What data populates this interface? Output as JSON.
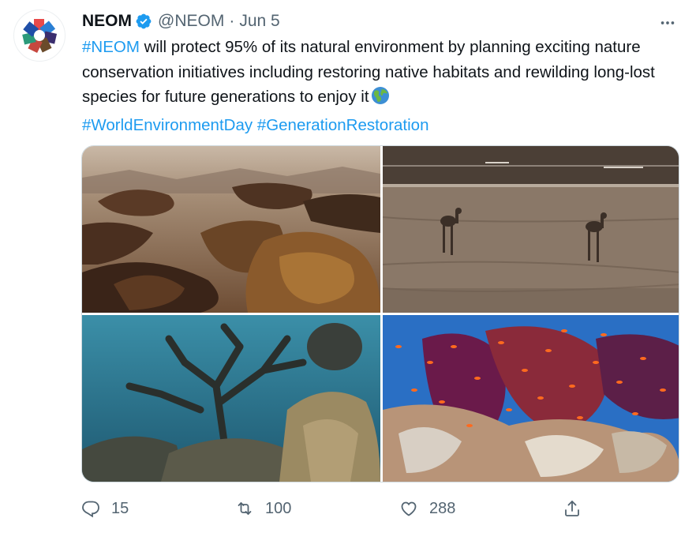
{
  "tweet": {
    "author_name": "NEOM",
    "handle": "@NEOM",
    "separator": "·",
    "date": "Jun 5",
    "text_hashtag": "#NEOM",
    "text_body": " will protect 95% of its natural environment by planning exciting nature conservation initiatives including restoring native habitats and rewilding long-lost species for future generations to enjoy it",
    "hashtag_2": "#WorldEnvironmentDay",
    "hashtag_3": "#GenerationRestoration"
  },
  "media": [
    {
      "subject": "aerial desert rock formations"
    },
    {
      "subject": "camel shadows on sandy road"
    },
    {
      "subject": "coral reef underwater"
    },
    {
      "subject": "colorful reef with orange fish"
    }
  ],
  "actions": {
    "replies": "15",
    "retweets": "100",
    "likes": "288"
  },
  "icons": [
    "verified-badge-icon",
    "more-icon",
    "globe-icon",
    "reply-icon",
    "retweet-icon",
    "like-icon",
    "share-icon"
  ],
  "colors": {
    "accent": "#1d9bf0",
    "muted": "#536471",
    "text": "#0f1419"
  }
}
